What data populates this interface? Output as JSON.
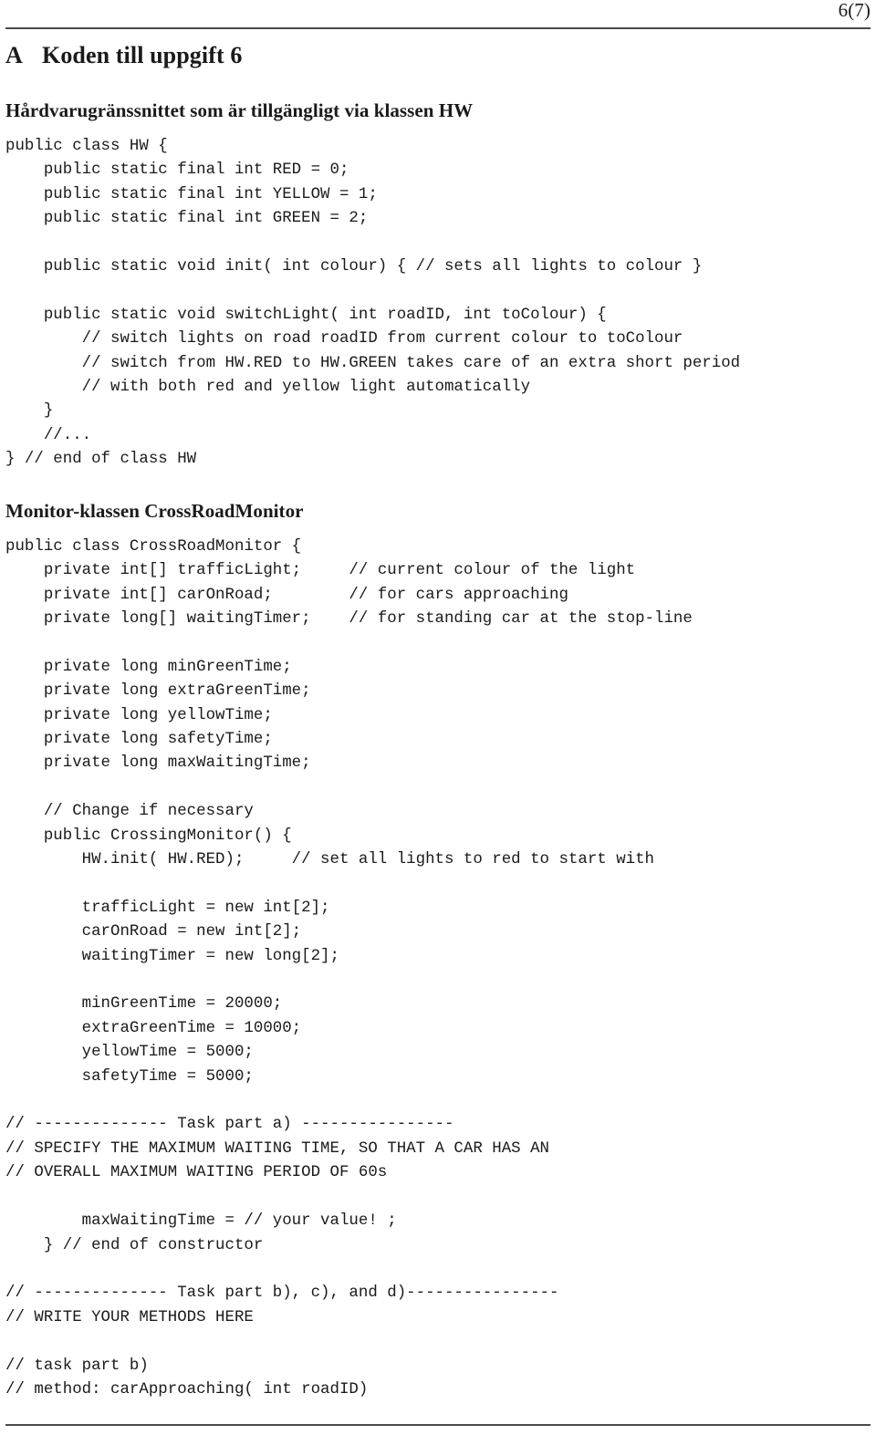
{
  "header": {
    "page_number": "6(7)"
  },
  "section": {
    "letter": "A",
    "title": "Koden till uppgift 6"
  },
  "subsections": [
    {
      "heading": "Hårdvarugränssnittet som är tillgängligt via klassen HW",
      "code": "public class HW {\n    public static final int RED = 0;\n    public static final int YELLOW = 1;\n    public static final int GREEN = 2;\n\n    public static void init( int colour) { // sets all lights to colour }\n\n    public static void switchLight( int roadID, int toColour) {\n        // switch lights on road roadID from current colour to toColour\n        // switch from HW.RED to HW.GREEN takes care of an extra short period\n        // with both red and yellow light automatically\n    }\n    //...\n} // end of class HW"
    },
    {
      "heading": "Monitor-klassen CrossRoadMonitor",
      "code": "public class CrossRoadMonitor {\n    private int[] trafficLight;     // current colour of the light\n    private int[] carOnRoad;        // for cars approaching\n    private long[] waitingTimer;    // for standing car at the stop-line\n\n    private long minGreenTime;\n    private long extraGreenTime;\n    private long yellowTime;\n    private long safetyTime;\n    private long maxWaitingTime;\n\n    // Change if necessary\n    public CrossingMonitor() {\n        HW.init( HW.RED);     // set all lights to red to start with\n\n        trafficLight = new int[2];\n        carOnRoad = new int[2];\n        waitingTimer = new long[2];\n\n        minGreenTime = 20000;\n        extraGreenTime = 10000;\n        yellowTime = 5000;\n        safetyTime = 5000;\n\n// -------------- Task part a) ----------------\n// SPECIFY THE MAXIMUM WAITING TIME, SO THAT A CAR HAS AN\n// OVERALL MAXIMUM WAITING PERIOD OF 60s\n\n        maxWaitingTime = // your value! ;\n    } // end of constructor\n\n// -------------- Task part b), c), and d)----------------\n// WRITE YOUR METHODS HERE\n\n// task part b)\n// method: carApproaching( int roadID)"
    }
  ]
}
